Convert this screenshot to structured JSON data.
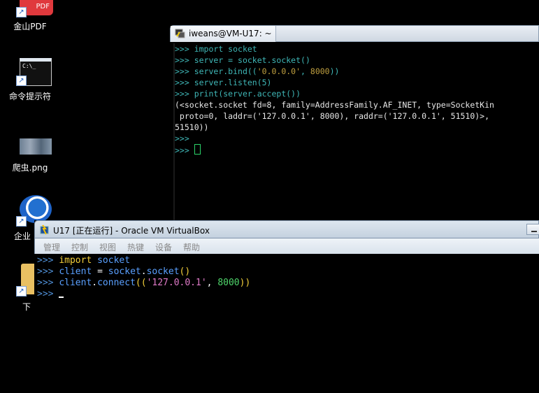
{
  "desktop": {
    "icons": [
      {
        "label": "金山PDF",
        "tile_text": "PDF",
        "icon": "pdf-icon"
      },
      {
        "label": "命令提示符",
        "tile_text": "C:\\_",
        "icon": "cmd-icon"
      },
      {
        "label": "爬虫.png",
        "icon": "image-file-icon"
      },
      {
        "label": "企业",
        "icon": "qq-enterprise-icon"
      },
      {
        "label": "下",
        "icon": "folder-icon"
      }
    ]
  },
  "terminal1": {
    "title": "iweans@VM-U17: ~",
    "lines": [
      [
        {
          "t": ">>> ",
          "c": "prompt"
        },
        {
          "t": "import socket",
          "c": "kw"
        }
      ],
      [
        {
          "t": ">>> ",
          "c": "prompt"
        },
        {
          "t": "server = socket.socket()",
          "c": "kw"
        }
      ],
      [
        {
          "t": ">>> ",
          "c": "prompt"
        },
        {
          "t": "server.bind((",
          "c": "kw"
        },
        {
          "t": "'0.0.0.0'",
          "c": "str"
        },
        {
          "t": ", ",
          "c": "kw"
        },
        {
          "t": "8000",
          "c": "num"
        },
        {
          "t": "))",
          "c": "kw"
        }
      ],
      [
        {
          "t": ">>> ",
          "c": "prompt"
        },
        {
          "t": "server.listen(5)",
          "c": "kw"
        }
      ],
      [
        {
          "t": ">>> ",
          "c": "prompt"
        },
        {
          "t": "print(server.accept())",
          "c": "kw"
        }
      ],
      [
        {
          "t": "(<socket.socket fd=8, family=AddressFamily.AF_INET, type=SocketKin",
          "c": "plain"
        }
      ],
      [
        {
          "t": " proto=0, laddr=('127.0.0.1', 8000), raddr=('127.0.0.1', 51510)>,",
          "c": "plain"
        }
      ],
      [
        {
          "t": "51510))",
          "c": "plain"
        }
      ],
      [
        {
          "t": ">>>",
          "c": "prompt"
        }
      ],
      [
        {
          "t": ">>> ",
          "c": "prompt"
        }
      ]
    ]
  },
  "virtualbox": {
    "title": "U17 [正在运行] - Oracle VM VirtualBox",
    "menu": [
      "管理",
      "控制",
      "视图",
      "热键",
      "设备",
      "帮助"
    ],
    "lines": [
      [
        {
          "t": ">>> ",
          "c": "prompt"
        },
        {
          "t": "import",
          "c": "kw"
        },
        {
          "t": " socket",
          "c": "name"
        }
      ],
      [
        {
          "t": ">>> ",
          "c": "prompt"
        },
        {
          "t": "client",
          "c": "name"
        },
        {
          "t": " = ",
          "c": "op"
        },
        {
          "t": "socket",
          "c": "name"
        },
        {
          "t": ".",
          "c": "op"
        },
        {
          "t": "socket",
          "c": "name"
        },
        {
          "t": "()",
          "c": "paren"
        }
      ],
      [
        {
          "t": ">>> ",
          "c": "prompt"
        },
        {
          "t": "client",
          "c": "name"
        },
        {
          "t": ".",
          "c": "op"
        },
        {
          "t": "connect",
          "c": "name"
        },
        {
          "t": "((",
          "c": "paren"
        },
        {
          "t": "'127.0.0.1'",
          "c": "str"
        },
        {
          "t": ", ",
          "c": "op"
        },
        {
          "t": "8000",
          "c": "num"
        },
        {
          "t": "))",
          "c": "paren"
        }
      ],
      [
        {
          "t": ">>> ",
          "c": "prompt"
        }
      ]
    ]
  }
}
